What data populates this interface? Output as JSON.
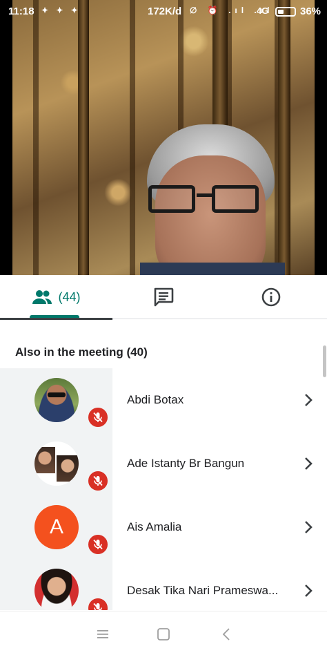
{
  "status_bar": {
    "time": "11:18",
    "notifications": "✦ ✦ ✦",
    "speed": "172K/d",
    "icons": "∅ ⏰ .ıl .ıl",
    "network": "4G",
    "battery": "36%",
    "battery_level": 0.36
  },
  "tabs": {
    "people_count": "(44)",
    "active": "people"
  },
  "section_title": "Also in the meeting (40)",
  "participants": [
    {
      "name": "Abdi Botax",
      "avatar": "photo",
      "muted": true
    },
    {
      "name": "Ade Istanty Br Bangun",
      "avatar": "photo-collage",
      "muted": true
    },
    {
      "name": "Ais Amalia",
      "avatar": "letter",
      "initial": "A",
      "avatar_color": "#f4511e",
      "muted": true
    },
    {
      "name": "Desak Tika Nari Prameswa...",
      "avatar": "photo",
      "muted": true
    }
  ],
  "colors": {
    "accent": "#00796b",
    "mute": "#d93025"
  },
  "icons": {
    "people_tab": "people-icon",
    "chat_tab": "chat-icon",
    "info_tab": "info-icon",
    "row_action": "chevron-right-icon",
    "mute": "mic-off-icon"
  }
}
